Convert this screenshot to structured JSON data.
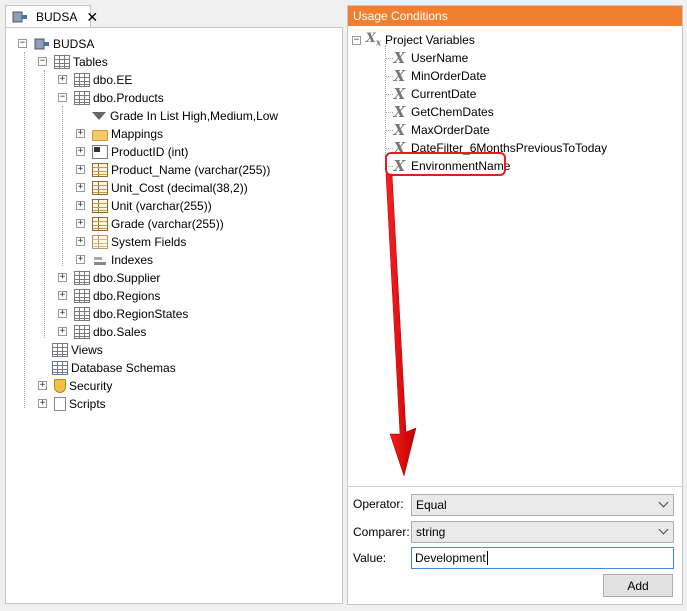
{
  "tab": {
    "title": "BUDSA",
    "close": "✕"
  },
  "tree": {
    "root": "BUDSA",
    "tables": "Tables",
    "ee": "dbo.EE",
    "products": "dbo.Products",
    "filter": "Grade In List High,Medium,Low",
    "mappings": "Mappings",
    "productid": "ProductID (int)",
    "product_name": "Product_Name (varchar(255))",
    "unit_cost": "Unit_Cost (decimal(38,2))",
    "unit": "Unit (varchar(255))",
    "grade": "Grade (varchar(255))",
    "system_fields": "System Fields",
    "indexes": "Indexes",
    "supplier": "dbo.Supplier",
    "regions": "dbo.Regions",
    "regionstates": "dbo.RegionStates",
    "sales": "dbo.Sales",
    "views": "Views",
    "schemas": "Database Schemas",
    "security": "Security",
    "scripts": "Scripts"
  },
  "usage": {
    "header": "Usage Conditions",
    "group": "Project Variables",
    "variables": [
      "UserName",
      "MinOrderDate",
      "CurrentDate",
      "GetChemDates",
      "MaxOrderDate",
      "DateFilter_6MonthsPreviousToToday",
      "EnvironmentName"
    ]
  },
  "form": {
    "operator_label": "Operator:",
    "operator_value": "Equal",
    "comparer_label": "Comparer:",
    "comparer_value": "string",
    "value_label": "Value:",
    "value_text": "Development",
    "add_label": "Add"
  },
  "colors": {
    "accent": "#f08030",
    "highlight": "#e02020"
  }
}
